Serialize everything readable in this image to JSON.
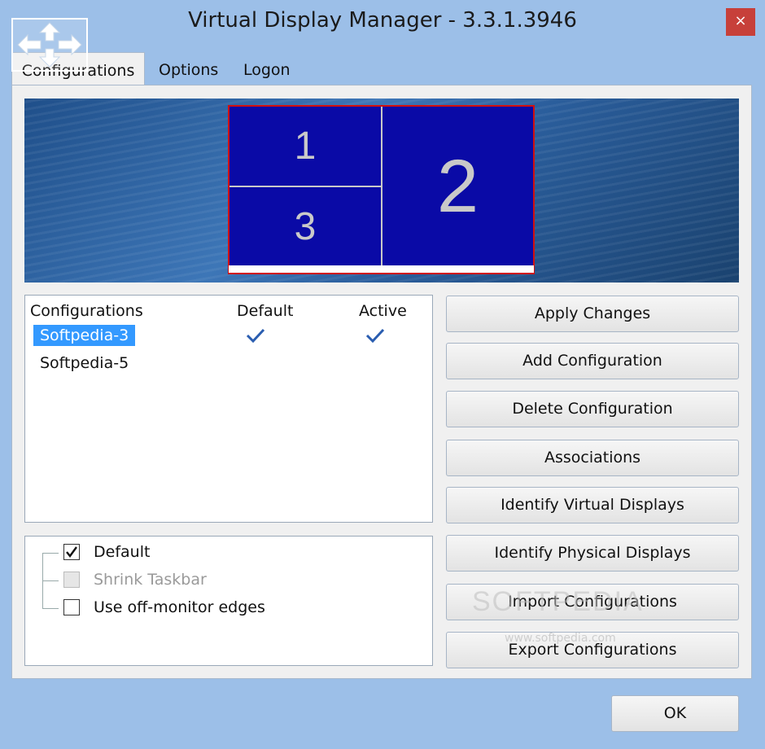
{
  "window": {
    "title": "Virtual Display Manager - 3.3.1.3946",
    "close_label": "×"
  },
  "tabs": [
    {
      "label": "Configurations",
      "active": true
    },
    {
      "label": "Options",
      "active": false
    },
    {
      "label": "Logon",
      "active": false
    }
  ],
  "preview": {
    "displays": [
      {
        "label": "1"
      },
      {
        "label": "2"
      },
      {
        "label": "3"
      }
    ]
  },
  "config_list": {
    "headers": {
      "name": "Configurations",
      "default": "Default",
      "active": "Active"
    },
    "rows": [
      {
        "name": "Softpedia-3",
        "default": true,
        "active": true,
        "selected": true
      },
      {
        "name": "Softpedia-5",
        "default": false,
        "active": false,
        "selected": false
      }
    ]
  },
  "options": [
    {
      "label": "Default",
      "checked": true,
      "disabled": false
    },
    {
      "label": "Shrink Taskbar",
      "checked": false,
      "disabled": true
    },
    {
      "label": "Use off-monitor edges",
      "checked": false,
      "disabled": false
    }
  ],
  "buttons": {
    "apply": "Apply Changes",
    "add": "Add Configuration",
    "delete": "Delete Configuration",
    "associations": "Associations",
    "identify_virtual": "Identify Virtual Displays",
    "identify_physical": "Identify Physical Displays",
    "import": "Import Configurations",
    "export": "Export Configurations",
    "ok": "OK"
  },
  "watermark": {
    "text": "SOFTPEDIA",
    "url": "www.softpedia.com"
  },
  "colors": {
    "selection": "#3399ff",
    "display_fill": "#0a0aa6",
    "display_border": "#d01010",
    "check": "#2a5db0",
    "close": "#c7403a"
  },
  "icons": {
    "app": "move-arrows-icon",
    "check": "checkmark-icon",
    "close": "close-icon"
  }
}
